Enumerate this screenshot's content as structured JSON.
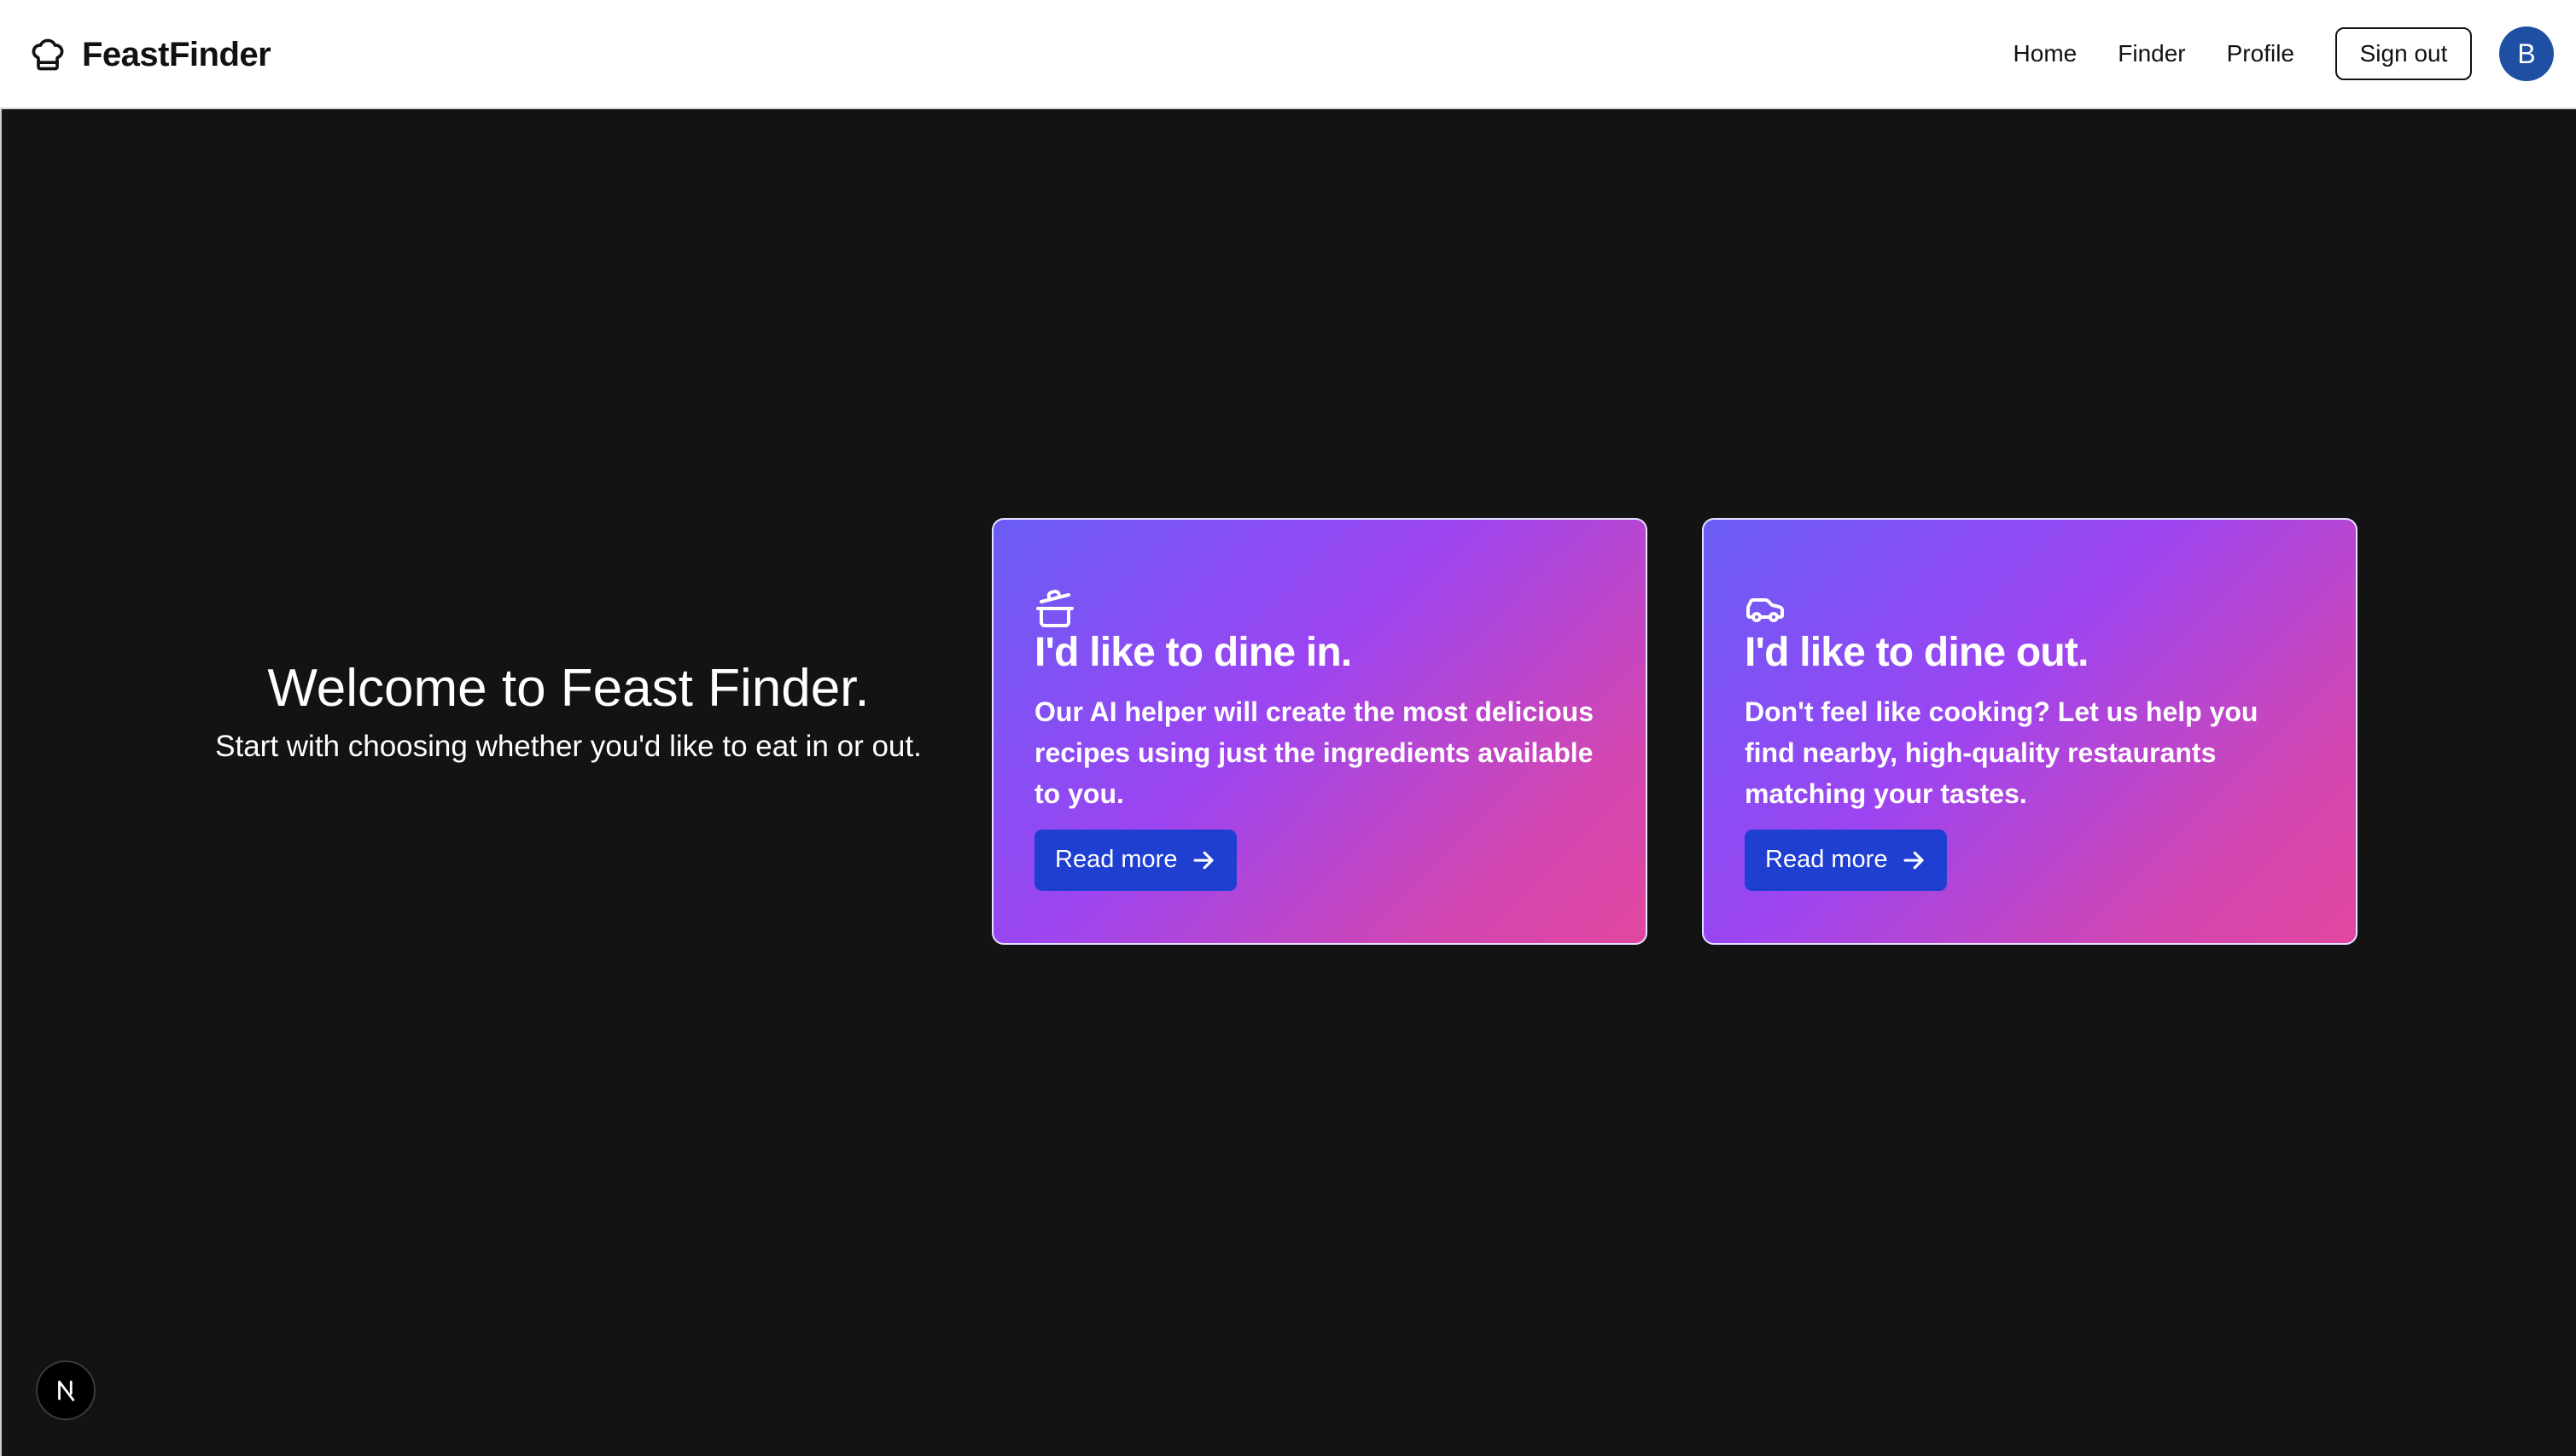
{
  "brand": {
    "name": "FeastFinder",
    "icon": "chef-hat-icon"
  },
  "nav": {
    "links": [
      {
        "label": "Home"
      },
      {
        "label": "Finder"
      },
      {
        "label": "Profile"
      }
    ],
    "sign_out_label": "Sign out",
    "avatar_initial": "B"
  },
  "welcome": {
    "title": "Welcome to Feast Finder.",
    "subtitle": "Start with choosing whether you'd like to eat in or out."
  },
  "cards": [
    {
      "icon": "cooking-pot-icon",
      "title": "I'd like to dine in.",
      "text": "Our AI helper will create the most delicious recipes using just the ingredients available to you.",
      "button_label": "Read more"
    },
    {
      "icon": "car-icon",
      "title": "I'd like to dine out.",
      "text": "Don't feel like cooking? Let us help you find nearby, high-quality restaurants matching your tastes.",
      "button_label": "Read more"
    }
  ],
  "dev_badge": {
    "label": "N"
  },
  "colors": {
    "background": "#131313",
    "navbar": "#ffffff",
    "avatar": "#1f4fa3",
    "button": "#1f3fd1",
    "gradient_start": "#6a5df5",
    "gradient_mid": "#9b45f2",
    "gradient_end": "#e1479f"
  }
}
